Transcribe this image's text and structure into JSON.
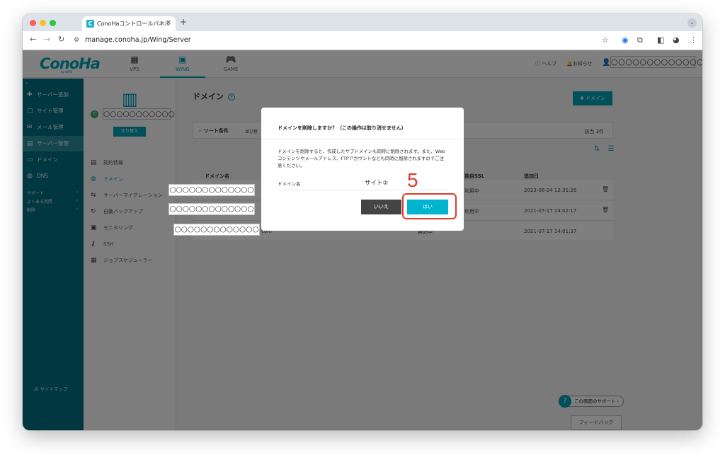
{
  "browser": {
    "tab_title": "ConoHaコントロールパネル",
    "tab_close": "×",
    "new_tab": "+",
    "url": "manage.conoha.jp/Wing/Server",
    "favicon": "C"
  },
  "header": {
    "logo": "ConoHa",
    "logo_sub": "by GMO",
    "nav": [
      {
        "label": "VPS",
        "icon": "▦"
      },
      {
        "label": "WING",
        "icon": "▣"
      },
      {
        "label": "GAME",
        "icon": "🎮"
      }
    ],
    "help": "ヘルプ",
    "news": "お知らせ",
    "user": "○○○○○○○○○○○○○"
  },
  "sidebar": {
    "items": [
      {
        "label": "サーバー追加",
        "icon": "✚"
      },
      {
        "label": "サイト管理",
        "icon": "▢"
      },
      {
        "label": "メール管理",
        "icon": "✉"
      },
      {
        "label": "サーバー管理",
        "icon": "▤"
      },
      {
        "label": "ドメイン",
        "icon": "▭"
      },
      {
        "label": "DNS",
        "icon": "◍"
      }
    ],
    "links": [
      "サポート",
      "よくある質問",
      "削除"
    ],
    "link_arrow": "›",
    "sitemap": "サイトマップ",
    "sitemap_icon": "⁂"
  },
  "subside": {
    "server_name": "○○○○○○○○○○○",
    "switch_label": "切り替え",
    "items": [
      {
        "label": "契約情報",
        "icon": "▤"
      },
      {
        "label": "ドメイン",
        "icon": "◍"
      },
      {
        "label": "サーバーマイグレーション",
        "icon": "⇆"
      },
      {
        "label": "自動バックアップ",
        "icon": "↻"
      },
      {
        "label": "モニタリング",
        "icon": "▣"
      },
      {
        "label": "SSH",
        "icon": "⚷"
      },
      {
        "label": "ジョブスケジューラー",
        "icon": "▦"
      }
    ]
  },
  "masks": [
    "○○○○○○○○○○○○○",
    "○○○○○○○○○○○○○",
    "○○○○○○○○○○○○○"
  ],
  "main": {
    "title": "ドメイン",
    "help_glyph": "?",
    "add_button": "✚ ドメイン",
    "sort_label": "ソート条件",
    "sort_sub": "並び替",
    "count": "該当 3件",
    "view_icons": "⇅ ☰",
    "headers": {
      "domain": "ドメイン名",
      "ssl": "独自SSL",
      "added": "追加日"
    },
    "rows": [
      {
        "domain": "",
        "ssl": "利用中",
        "added": "2023-08-24 12:31:26",
        "trash": "🗑"
      },
      {
        "domain": "",
        "ssl": "利用中",
        "added": "2021-07-17 14:02:17",
        "trash": "🗑"
      },
      {
        "domain": "com",
        "ssl": "無効中",
        "added": "2021-07-17 14:01:37",
        "trash": ""
      }
    ],
    "support": "この画面のサポート",
    "support_arrow": "›",
    "feedback": "フィードバック"
  },
  "modal": {
    "title": "ドメインを削除しますか？（この操作は取り消せません）",
    "body": "ドメインを削除すると、作成したサブドメインも同時に削除されます。また、Webコンテンツやメールアドレス、FTPアカウントなども同時に削除されますのでご注意ください。",
    "field_label": "ドメイン名",
    "field_value": "サイト②",
    "no_button": "いいえ",
    "yes_button": "はい"
  },
  "annotation": {
    "step": "5"
  },
  "colors": {
    "accent": "#00a0b9",
    "sidebar": "#006f82",
    "highlight": "#e03a28"
  }
}
